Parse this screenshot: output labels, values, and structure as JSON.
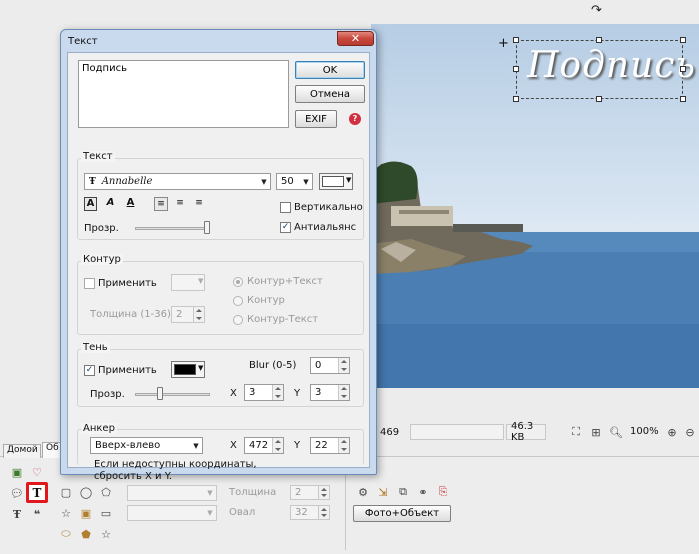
{
  "dialog": {
    "title": "Текст",
    "text_value": "Подпись",
    "ok_label": "OK",
    "cancel_label": "Отмена",
    "exif_label": "EXIF",
    "text_group": {
      "title": "Текст",
      "font_value": "Annabelle",
      "size_value": "50",
      "vertical_label": "Вертикально",
      "antialias_label": "Антиальянс",
      "opacity_label": "Прозр."
    },
    "contour_group": {
      "title": "Контур",
      "apply_label": "Применить",
      "thickness_label": "Толщина (1-36)",
      "thickness_value": "2",
      "radio_contour_text": "Контур+Текст",
      "radio_contour": "Контур",
      "radio_contour_minus_text": "Контур-Текст"
    },
    "shadow_group": {
      "title": "Тень",
      "apply_label": "Применить",
      "blur_label": "Blur (0-5)",
      "blur_value": "0",
      "opacity_label": "Прозр.",
      "x_label": "X",
      "x_value": "3",
      "y_label": "Y",
      "y_value": "3"
    },
    "anchor_group": {
      "title": "Анкер",
      "anchor_value": "Вверх-влево",
      "x_label": "X",
      "x_value": "472",
      "y_label": "Y",
      "y_value": "22",
      "note": "Если недоступны координаты, сбросить X и Y."
    }
  },
  "canvas": {
    "overlay_text": "Подпись"
  },
  "statusbar": {
    "coord_value": "469",
    "filesize": "46.3 KB",
    "zoom": "100%"
  },
  "bottom_panel": {
    "tab_home": "Домой",
    "tab_object": "Об",
    "thickness_label": "Толщина",
    "thickness_value": "2",
    "oval_label": "Овал",
    "oval_value": "32",
    "photo_object_button": "Фото+Объект"
  },
  "colors": {
    "dialog_bg": "#f0f0f0",
    "titlebar": "#c2d7ee",
    "close_button": "#c8493d",
    "sea": "#4a7eb3",
    "sky": "#ccdcec",
    "highlight_red": "#e0181d"
  }
}
